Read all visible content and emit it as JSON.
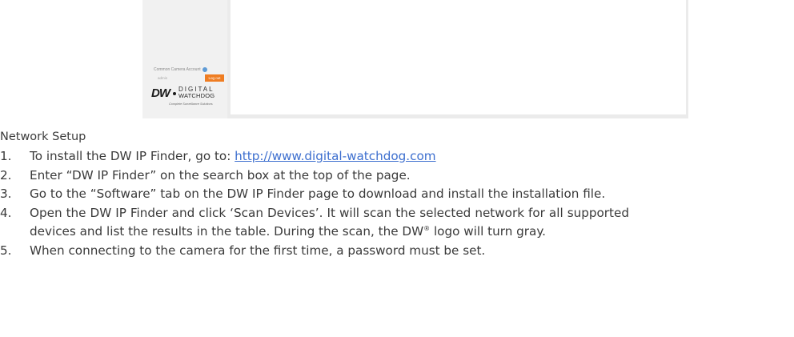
{
  "screenshot": {
    "account_label": "Common Camera Account",
    "account_value": "admin",
    "logout_label": "Log out",
    "logo": {
      "dw": "DW",
      "digital": "DIGITAL",
      "watchdog": "WATCHDOG",
      "tagline": "Complete Surveillance Solutions"
    }
  },
  "doc": {
    "heading": "Network Setup",
    "steps": [
      {
        "num": "1.",
        "text": "To install the DW IP Finder, go to: ",
        "link": "http://www.digital-watchdog.com"
      },
      {
        "num": "2.",
        "text": "Enter “DW IP Finder” on the search box at the top of the page."
      },
      {
        "num": "3.",
        "text": "Go to the “Software” tab on the DW IP Finder page to download and install the installation file."
      },
      {
        "num": "4.",
        "text_before": "Open the DW IP Finder and click ‘Scan Devices’. It will scan the selected network for all supported devices and list the results in the table. During the scan, the DW",
        "reg": "®",
        "text_after": " logo will turn gray."
      },
      {
        "num": "5.",
        "text": "When connecting to the camera for the first time, a password must be set."
      }
    ]
  }
}
